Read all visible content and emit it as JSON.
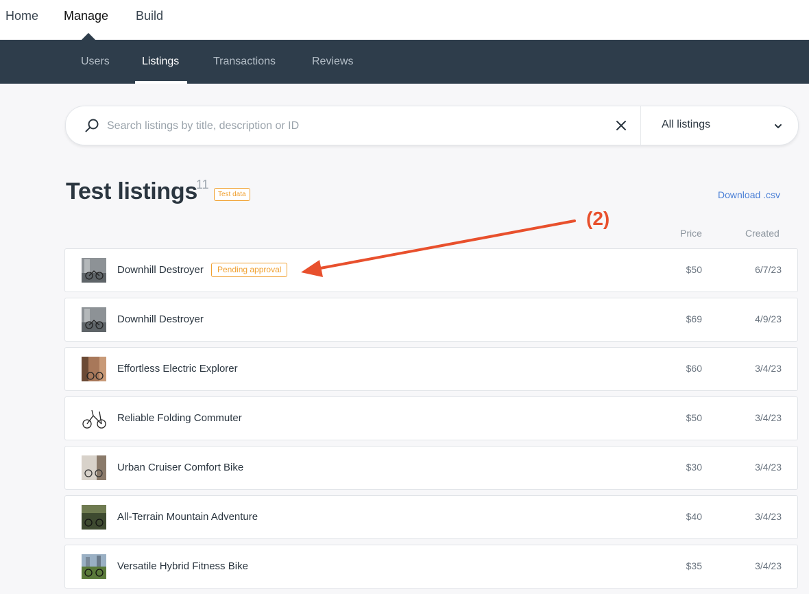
{
  "top_nav": {
    "home": "Home",
    "manage": "Manage",
    "build": "Build"
  },
  "sub_nav": {
    "users": "Users",
    "listings": "Listings",
    "transactions": "Transactions",
    "reviews": "Reviews"
  },
  "search": {
    "placeholder": "Search listings by title, description or ID",
    "value": "",
    "filter_value": "All listings"
  },
  "heading": {
    "title": "Test listings",
    "count": "11",
    "badge": "Test data",
    "download": "Download .csv"
  },
  "columns": {
    "price": "Price",
    "created": "Created"
  },
  "listings": [
    {
      "name": "Downhill Destroyer",
      "status": "Pending approval",
      "price": "$50",
      "created": "6/7/23"
    },
    {
      "name": "Downhill Destroyer",
      "status": "",
      "price": "$69",
      "created": "4/9/23"
    },
    {
      "name": "Effortless Electric Explorer",
      "status": "",
      "price": "$60",
      "created": "3/4/23"
    },
    {
      "name": "Reliable Folding Commuter",
      "status": "",
      "price": "$50",
      "created": "3/4/23"
    },
    {
      "name": "Urban Cruiser Comfort Bike",
      "status": "",
      "price": "$30",
      "created": "3/4/23"
    },
    {
      "name": "All-Terrain Mountain Adventure",
      "status": "",
      "price": "$40",
      "created": "3/4/23"
    },
    {
      "name": "Versatile Hybrid Fitness Bike",
      "status": "",
      "price": "$35",
      "created": "3/4/23"
    }
  ],
  "annotation": {
    "label": "(2)",
    "color": "#e8502d"
  },
  "colors": {
    "subnav_bg": "#2e3d4b",
    "accent_orange": "#f0a030",
    "link_blue": "#4a7fd6"
  }
}
